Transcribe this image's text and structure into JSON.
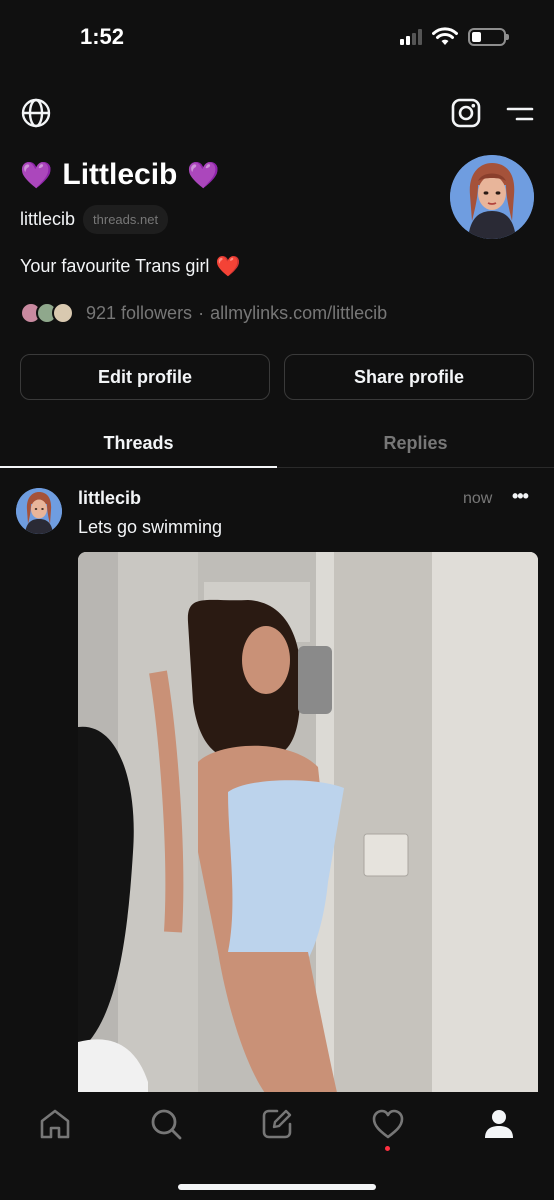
{
  "status": {
    "time": "1:52",
    "battery_level": 0.3
  },
  "profile": {
    "display_name": "Littlecib",
    "name_emoji_left": "💜",
    "name_emoji_right": "💜",
    "username": "littlecib",
    "domain_badge": "threads.net",
    "bio": "Your favourite Trans girl",
    "bio_emoji": "❤️",
    "followers": "921 followers",
    "link": "allmylinks.com/littlecib"
  },
  "buttons": {
    "edit": "Edit profile",
    "share": "Share profile"
  },
  "tabs": [
    {
      "label": "Threads",
      "active": true
    },
    {
      "label": "Replies",
      "active": false
    }
  ],
  "post": {
    "username": "littlecib",
    "time": "now",
    "more": "•••",
    "text": "Lets go swimming",
    "image_alt": "photo"
  },
  "icons": {
    "globe": "globe-icon",
    "instagram": "instagram-icon",
    "menu": "menu-icon",
    "home": "home-icon",
    "search": "search-icon",
    "compose": "compose-icon",
    "activity": "heart-icon",
    "profile": "profile-icon"
  },
  "colors": {
    "background": "#101010",
    "text": "#f3f5f7",
    "secondary": "#777777",
    "notification": "#ff3040",
    "emoji_heart": "#9b4dff"
  }
}
